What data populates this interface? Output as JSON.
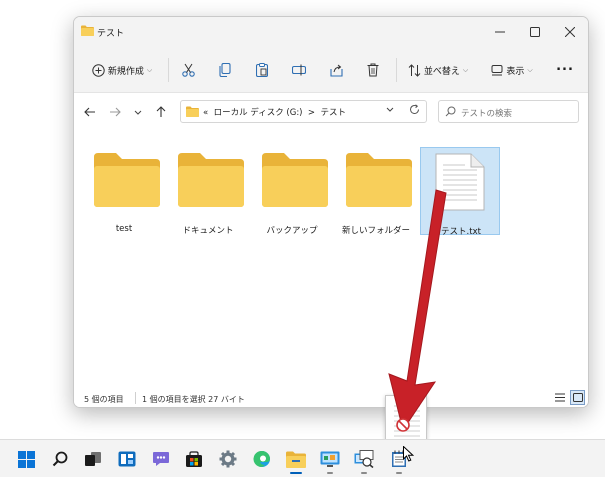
{
  "window": {
    "title": "テスト",
    "toolbar": {
      "new_label": "新規作成",
      "sort_label": "並べ替え",
      "view_label": "表示",
      "more_label": "..."
    },
    "address": {
      "prefix": "«",
      "crumbs": [
        "ローカル ディスク (G:)",
        "テスト"
      ],
      "separator": ">",
      "search_placeholder": "テストの検索"
    },
    "items": [
      {
        "label": "test",
        "type": "folder",
        "selected": false
      },
      {
        "label": "ドキュメント",
        "type": "folder",
        "selected": false
      },
      {
        "label": "バックアップ",
        "type": "folder",
        "selected": false
      },
      {
        "label": "新しいフォルダー",
        "type": "folder",
        "selected": false
      },
      {
        "label": "テスト.txt",
        "type": "text-file",
        "selected": true
      }
    ],
    "status": {
      "count": "5 個の項目",
      "selection": "1 個の項目を選択  27 バイト"
    }
  },
  "taskbar": {
    "icons": [
      "windows-start-icon",
      "search-icon",
      "task-view-icon",
      "widgets-icon",
      "teams-chat-icon",
      "store-icon",
      "settings-icon",
      "edge-icon",
      "file-explorer-icon",
      "control-panel-icon",
      "remote-desktop-icon",
      "notepad-icon"
    ],
    "active": "file-explorer-icon"
  },
  "colors": {
    "folder_body": "#f8cf5a",
    "folder_tab": "#e9b339",
    "selection": "#cce4f7",
    "selection_border": "#99c9ef",
    "annotation_arrow": "#c82128",
    "accent": "#005fb8"
  }
}
